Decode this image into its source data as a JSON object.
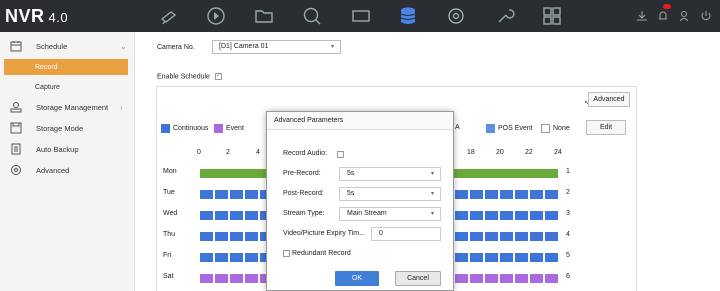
{
  "app": {
    "logo": "NVR",
    "version": "4.0"
  },
  "topnav": {
    "icons": [
      "camera-icon",
      "playback-icon",
      "folder-icon",
      "search-icon",
      "hdd-icon",
      "storage-icon",
      "settings-icon",
      "maintenance-icon",
      "layout-icon"
    ],
    "active": "storage-icon"
  },
  "sidebar": {
    "schedule": "Schedule",
    "record": "Record",
    "capture": "Capture",
    "storage_management": "Storage Management",
    "storage_mode": "Storage Mode",
    "auto_backup": "Auto Backup",
    "advanced": "Advanced"
  },
  "main": {
    "camera_label": "Camera No.",
    "camera_value": "[D1] Camera 01",
    "enable_label": "Enable Schedule",
    "advanced_button": "Advanced",
    "edit_button": "Edit",
    "legend": {
      "continuous": "Continuous",
      "event": "Event",
      "a_suffix": "A",
      "pos_event": "POS Event",
      "none": "None"
    },
    "hours": [
      "0",
      "2",
      "4",
      "18",
      "20",
      "22",
      "24"
    ],
    "days": [
      {
        "name": "Mon",
        "num": "1",
        "color": "#6aaa3a"
      },
      {
        "name": "Tue",
        "num": "2",
        "color": "#3f74d8"
      },
      {
        "name": "Wed",
        "num": "3",
        "color": "#3f74d8"
      },
      {
        "name": "Thu",
        "num": "4",
        "color": "#3f74d8"
      },
      {
        "name": "Fri",
        "num": "5",
        "color": "#3f74d8"
      },
      {
        "name": "Sat",
        "num": "6",
        "color": "#a96ae0"
      }
    ]
  },
  "colors": {
    "continuous": "#3f74d8",
    "event": "#a96ae0",
    "pos_event": "#5b8fe0",
    "green": "#6aaa3a",
    "accent": "#e8a040"
  },
  "dialog": {
    "title": "Advanced Parameters",
    "record_audio": "Record Audio:",
    "pre_record": "Pre-Record:",
    "pre_record_value": "5s",
    "post_record": "Post-Record:",
    "post_record_value": "5s",
    "stream_type": "Stream Type:",
    "stream_type_value": "Main Stream",
    "expiry": "Video/Picture Expiry Tim...",
    "expiry_value": "0",
    "redundant": "Redundant Record",
    "ok": "OK",
    "cancel": "Cancel"
  }
}
